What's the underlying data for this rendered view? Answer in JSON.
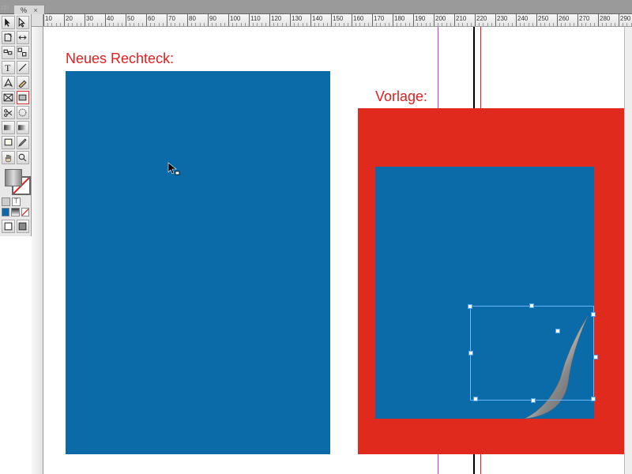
{
  "tab": {
    "zoom_label": "%",
    "close": "×"
  },
  "ruler": {
    "start": 10,
    "end": 290,
    "step": 10
  },
  "annotations": {
    "left_label": "Neues Rechteck:",
    "right_label": "Vorlage:"
  },
  "colors": {
    "blue": "#0b6aa8",
    "red": "#e02a1e",
    "annotation": "#e02020",
    "guide_magenta": "#c040c0"
  },
  "tools": {
    "selection": "selection-tool",
    "direct_select": "direct-selection-tool",
    "page": "page-tool",
    "gap": "gap-tool",
    "content": "content-tool",
    "type": "type-tool",
    "line": "line-tool",
    "pen": "pen-tool",
    "pencil": "pencil-tool",
    "rectangle_frame": "rectangle-frame-tool",
    "rectangle": "rectangle-tool",
    "scissors": "scissors-tool",
    "free_transform": "free-transform-tool",
    "gradient_swatch": "gradient-swatch-tool",
    "gradient_feather": "gradient-feather-tool",
    "note": "note-tool",
    "eyedropper": "eyedropper-tool",
    "hand": "hand-tool",
    "zoom": "zoom-tool"
  }
}
